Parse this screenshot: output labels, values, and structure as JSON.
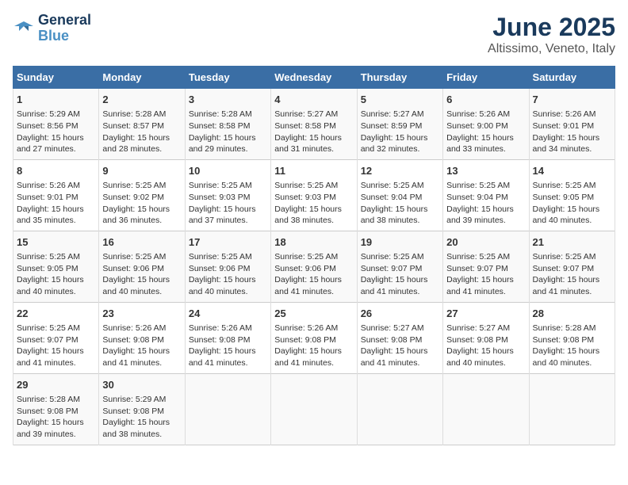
{
  "logo": {
    "line1": "General",
    "line2": "Blue"
  },
  "title": "June 2025",
  "subtitle": "Altissimo, Veneto, Italy",
  "headers": [
    "Sunday",
    "Monday",
    "Tuesday",
    "Wednesday",
    "Thursday",
    "Friday",
    "Saturday"
  ],
  "weeks": [
    [
      {
        "day": "1",
        "info": "Sunrise: 5:29 AM\nSunset: 8:56 PM\nDaylight: 15 hours\nand 27 minutes."
      },
      {
        "day": "2",
        "info": "Sunrise: 5:28 AM\nSunset: 8:57 PM\nDaylight: 15 hours\nand 28 minutes."
      },
      {
        "day": "3",
        "info": "Sunrise: 5:28 AM\nSunset: 8:58 PM\nDaylight: 15 hours\nand 29 minutes."
      },
      {
        "day": "4",
        "info": "Sunrise: 5:27 AM\nSunset: 8:58 PM\nDaylight: 15 hours\nand 31 minutes."
      },
      {
        "day": "5",
        "info": "Sunrise: 5:27 AM\nSunset: 8:59 PM\nDaylight: 15 hours\nand 32 minutes."
      },
      {
        "day": "6",
        "info": "Sunrise: 5:26 AM\nSunset: 9:00 PM\nDaylight: 15 hours\nand 33 minutes."
      },
      {
        "day": "7",
        "info": "Sunrise: 5:26 AM\nSunset: 9:01 PM\nDaylight: 15 hours\nand 34 minutes."
      }
    ],
    [
      {
        "day": "8",
        "info": "Sunrise: 5:26 AM\nSunset: 9:01 PM\nDaylight: 15 hours\nand 35 minutes."
      },
      {
        "day": "9",
        "info": "Sunrise: 5:25 AM\nSunset: 9:02 PM\nDaylight: 15 hours\nand 36 minutes."
      },
      {
        "day": "10",
        "info": "Sunrise: 5:25 AM\nSunset: 9:03 PM\nDaylight: 15 hours\nand 37 minutes."
      },
      {
        "day": "11",
        "info": "Sunrise: 5:25 AM\nSunset: 9:03 PM\nDaylight: 15 hours\nand 38 minutes."
      },
      {
        "day": "12",
        "info": "Sunrise: 5:25 AM\nSunset: 9:04 PM\nDaylight: 15 hours\nand 38 minutes."
      },
      {
        "day": "13",
        "info": "Sunrise: 5:25 AM\nSunset: 9:04 PM\nDaylight: 15 hours\nand 39 minutes."
      },
      {
        "day": "14",
        "info": "Sunrise: 5:25 AM\nSunset: 9:05 PM\nDaylight: 15 hours\nand 40 minutes."
      }
    ],
    [
      {
        "day": "15",
        "info": "Sunrise: 5:25 AM\nSunset: 9:05 PM\nDaylight: 15 hours\nand 40 minutes."
      },
      {
        "day": "16",
        "info": "Sunrise: 5:25 AM\nSunset: 9:06 PM\nDaylight: 15 hours\nand 40 minutes."
      },
      {
        "day": "17",
        "info": "Sunrise: 5:25 AM\nSunset: 9:06 PM\nDaylight: 15 hours\nand 40 minutes."
      },
      {
        "day": "18",
        "info": "Sunrise: 5:25 AM\nSunset: 9:06 PM\nDaylight: 15 hours\nand 41 minutes."
      },
      {
        "day": "19",
        "info": "Sunrise: 5:25 AM\nSunset: 9:07 PM\nDaylight: 15 hours\nand 41 minutes."
      },
      {
        "day": "20",
        "info": "Sunrise: 5:25 AM\nSunset: 9:07 PM\nDaylight: 15 hours\nand 41 minutes."
      },
      {
        "day": "21",
        "info": "Sunrise: 5:25 AM\nSunset: 9:07 PM\nDaylight: 15 hours\nand 41 minutes."
      }
    ],
    [
      {
        "day": "22",
        "info": "Sunrise: 5:25 AM\nSunset: 9:07 PM\nDaylight: 15 hours\nand 41 minutes."
      },
      {
        "day": "23",
        "info": "Sunrise: 5:26 AM\nSunset: 9:08 PM\nDaylight: 15 hours\nand 41 minutes."
      },
      {
        "day": "24",
        "info": "Sunrise: 5:26 AM\nSunset: 9:08 PM\nDaylight: 15 hours\nand 41 minutes."
      },
      {
        "day": "25",
        "info": "Sunrise: 5:26 AM\nSunset: 9:08 PM\nDaylight: 15 hours\nand 41 minutes."
      },
      {
        "day": "26",
        "info": "Sunrise: 5:27 AM\nSunset: 9:08 PM\nDaylight: 15 hours\nand 41 minutes."
      },
      {
        "day": "27",
        "info": "Sunrise: 5:27 AM\nSunset: 9:08 PM\nDaylight: 15 hours\nand 40 minutes."
      },
      {
        "day": "28",
        "info": "Sunrise: 5:28 AM\nSunset: 9:08 PM\nDaylight: 15 hours\nand 40 minutes."
      }
    ],
    [
      {
        "day": "29",
        "info": "Sunrise: 5:28 AM\nSunset: 9:08 PM\nDaylight: 15 hours\nand 39 minutes."
      },
      {
        "day": "30",
        "info": "Sunrise: 5:29 AM\nSunset: 9:08 PM\nDaylight: 15 hours\nand 38 minutes."
      },
      {
        "day": "",
        "info": ""
      },
      {
        "day": "",
        "info": ""
      },
      {
        "day": "",
        "info": ""
      },
      {
        "day": "",
        "info": ""
      },
      {
        "day": "",
        "info": ""
      }
    ]
  ]
}
